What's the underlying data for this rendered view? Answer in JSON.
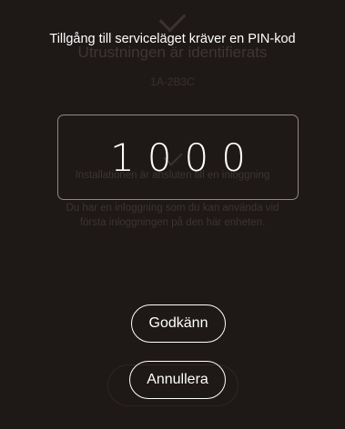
{
  "background": {
    "title": "Utrustningen är identifierats",
    "code": "1A-2B3C",
    "line1": "Installationen är ansluten till en inloggning",
    "line2": "Du har en inloggning som du kan använda vid",
    "line3": "första inloggningen på den här enheten."
  },
  "dialog": {
    "prompt": "Tillgång till serviceläget kräver en PIN-kod",
    "pin_value": "1000",
    "accept_label": "Godkänn",
    "cancel_label": "Annullera"
  },
  "colors": {
    "background": "#1e1817",
    "text": "#ffffff",
    "border": "#8f8886"
  }
}
